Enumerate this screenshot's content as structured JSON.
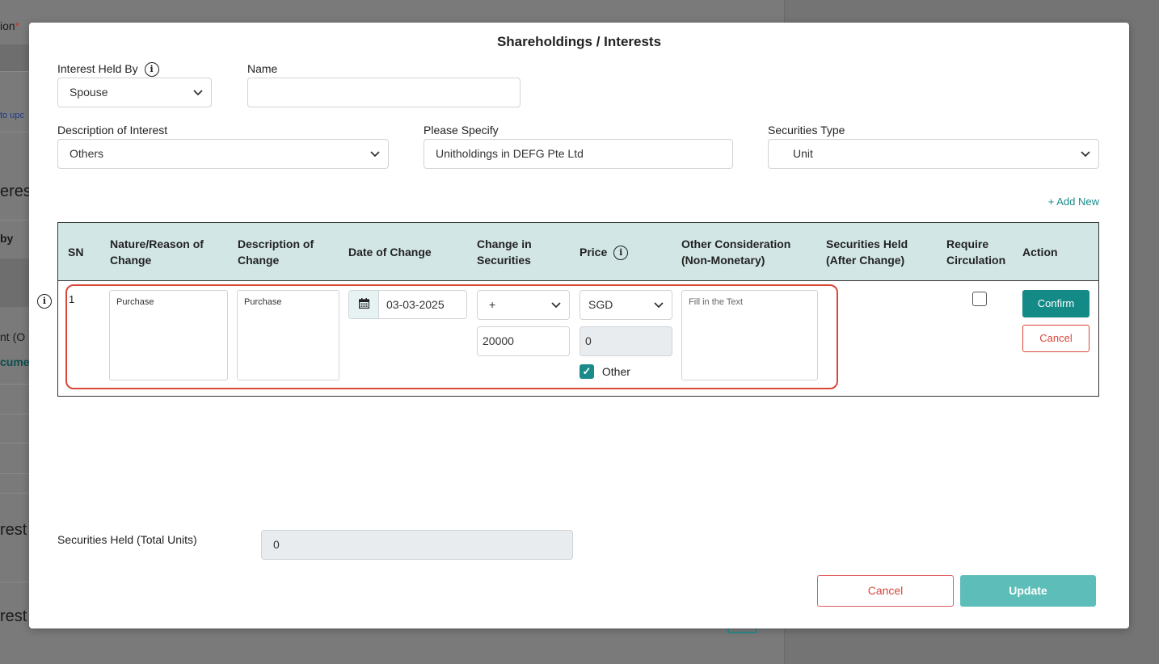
{
  "background": {
    "fragments": [
      "ion",
      "*",
      "to upc",
      "eres",
      "by",
      "nt (O",
      "cume",
      "rest",
      "rest"
    ]
  },
  "modal": {
    "title": "Shareholdings / Interests",
    "interest_held_by": {
      "label": "Interest Held By",
      "value": "Spouse"
    },
    "name": {
      "label": "Name",
      "value": ""
    },
    "description_of_interest": {
      "label": "Description of Interest",
      "value": "Others"
    },
    "please_specify": {
      "label": "Please Specify",
      "value": "Unitholdings in DEFG Pte Ltd"
    },
    "securities_type": {
      "label": "Securities Type",
      "value": "Unit"
    },
    "add_new_label": "+ Add New",
    "table": {
      "headers": {
        "sn": "SN",
        "nature_1": "Nature/Reason of",
        "nature_2": "Change",
        "desc_1": "Description of",
        "desc_2": "Change",
        "date": "Date of Change",
        "change_1": "Change in",
        "change_2": "Securities",
        "price": "Price",
        "other_1": "Other Consideration",
        "other_2": "(Non-Monetary)",
        "held_1": "Securities Held",
        "held_2": "(After Change)",
        "req_1": "Require",
        "req_2": "Circulation",
        "action": "Action"
      },
      "row": {
        "sn": "1",
        "nature": "Purchase",
        "description": "Purchase",
        "date": "03-03-2025",
        "change_sign": "+",
        "change_amount": "20000",
        "currency": "SGD",
        "price_value": "0",
        "other_checkbox_label": "Other",
        "other_checked": true,
        "other_consideration_placeholder": "Fill in the Text",
        "require_circulation": false,
        "confirm_label": "Confirm",
        "cancel_label": "Cancel"
      }
    },
    "total": {
      "label": "Securities Held (Total Units)",
      "value": "0"
    },
    "footer": {
      "cancel_label": "Cancel",
      "update_label": "Update"
    }
  },
  "colors": {
    "accent": "#148a86",
    "header_bg": "#d2e6e6",
    "danger": "#d9473a",
    "update_bg": "#5dbdb8"
  }
}
